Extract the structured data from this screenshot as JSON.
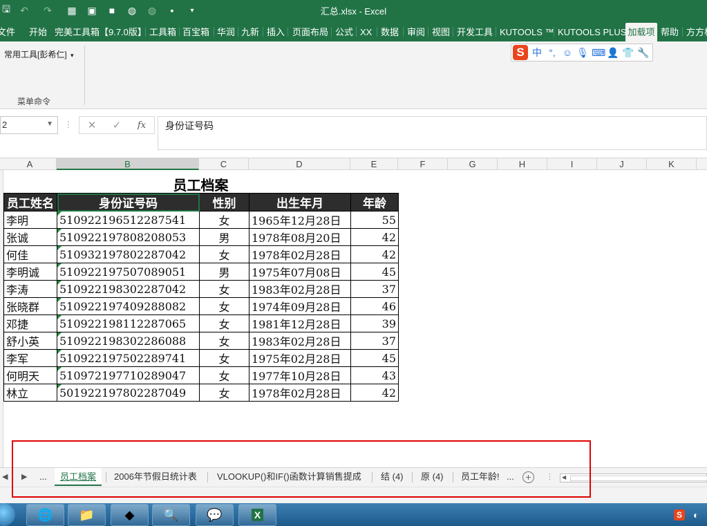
{
  "window": {
    "title": "汇总.xlsx  -  Excel"
  },
  "menu": {
    "tabs": [
      "文件",
      "开始",
      "完美工具箱【9.7.0版】",
      "工具箱",
      "百宝箱",
      "华润",
      "九新",
      "插入",
      "页面布局",
      "公式",
      "XX",
      "数据",
      "审阅",
      "视图",
      "开发工具",
      "KUTOOLS ™",
      "KUTOOLS PLUS",
      "加载项",
      "帮助",
      "方方格子"
    ],
    "active": "加载项"
  },
  "ribbon": {
    "dropdown_label": "常用工具[彭希仁]",
    "group_label": "菜单命令"
  },
  "formula_bar": {
    "name_box": "2",
    "content": "身份证号码"
  },
  "columns": [
    "A",
    "B",
    "C",
    "D",
    "E",
    "F",
    "G",
    "H",
    "I",
    "J",
    "K"
  ],
  "sheet": {
    "title": "员工档案",
    "headers": [
      "员工姓名",
      "身份证号码",
      "性别",
      "出生年月",
      "年龄"
    ],
    "rows": [
      [
        "李明",
        "510922196512287541",
        "女",
        "1965年12月28日",
        "55"
      ],
      [
        "张诚",
        "510922197808208053",
        "男",
        "1978年08月20日",
        "42"
      ],
      [
        "何佳",
        "510932197802287042",
        "女",
        "1978年02月28日",
        "42"
      ],
      [
        "李明诚",
        "510922197507089051",
        "男",
        "1975年07月08日",
        "45"
      ],
      [
        "李涛",
        "510922198302287042",
        "女",
        "1983年02月28日",
        "37"
      ],
      [
        "张晓群",
        "510922197409288082",
        "女",
        "1974年09月28日",
        "46"
      ],
      [
        "邓捷",
        "510922198112287065",
        "女",
        "1981年12月28日",
        "39"
      ],
      [
        "舒小英",
        "510922198302286088",
        "女",
        "1983年02月28日",
        "37"
      ],
      [
        "李军",
        "510922197502289741",
        "女",
        "1975年02月28日",
        "45"
      ],
      [
        "何明天",
        "510972197710289047",
        "女",
        "1977年10月28日",
        "43"
      ],
      [
        "林立",
        "501922197802287049",
        "女",
        "1978年02月28日",
        "42"
      ]
    ]
  },
  "sheet_tabs": {
    "ellipsis": "...",
    "tabs": [
      "员工档案",
      "2006年节假日统计表",
      "VLOOKUP()和IF()函数计算销售提成",
      "结 (4)",
      "原 (4)",
      "员工年龄!"
    ],
    "active": "员工档案",
    "add_label": "+"
  },
  "ime": {
    "logo": "S",
    "mode": "中"
  },
  "tray": {
    "ime_logo": "S"
  },
  "colors": {
    "excel_green": "#217346",
    "highlight_red": "#e00000",
    "header_fill": "#2d2d2d"
  }
}
